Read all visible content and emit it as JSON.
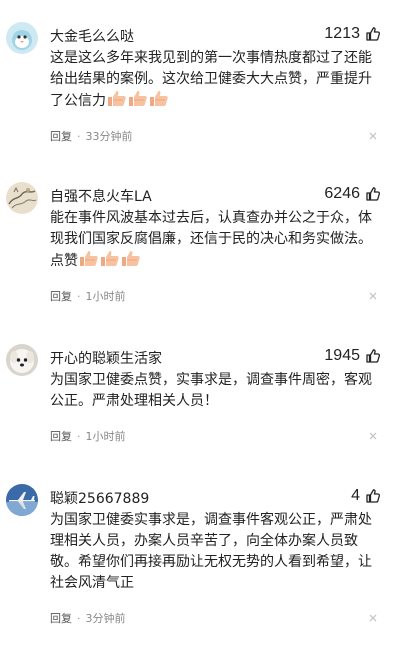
{
  "comments": [
    {
      "username": "大金毛么么哒",
      "likes": "1213",
      "text": "这是这么多年来我见到的第一次事情热度都过了还能给出结果的案例。这次给卫健委大大点赞，严重提升了公信力",
      "emoji_count": 3,
      "reply_label": "回复",
      "time": "33分钟前",
      "avatar_icon": "blue-bird-avatar"
    },
    {
      "username": "自强不息火车LA",
      "likes": "6246",
      "text": "能在事件风波基本过去后，认真查办并公之于众，体现我们国家反腐倡廉，还信于民的决心和务实做法。点赞",
      "emoji_count": 3,
      "reply_label": "回复",
      "time": "1小时前",
      "avatar_icon": "ink-painting-avatar"
    },
    {
      "username": "开心的聪颖生活家",
      "likes": "1945",
      "text": "为国家卫健委点赞，实事求是，调查事件周密，客观公正。严肃处理相关人员！",
      "emoji_count": 0,
      "reply_label": "回复",
      "time": "1小时前",
      "avatar_icon": "white-dog-avatar"
    },
    {
      "username": "聪颖25667889",
      "likes": "4",
      "text": "为国家卫健委实事求是，调查事件客观公正，严肃处理相关人员，办案人员辛苦了，向全体办案人员致敬。希望你们再接再励让无权无势的人看到希望，让社会风清气正",
      "emoji_count": 0,
      "reply_label": "回复",
      "time": "3分钟前",
      "avatar_icon": "airplane-avatar"
    }
  ],
  "colors": {
    "text": "#222222",
    "meta": "#888888",
    "thumbs_emoji": "#f5b98f"
  }
}
